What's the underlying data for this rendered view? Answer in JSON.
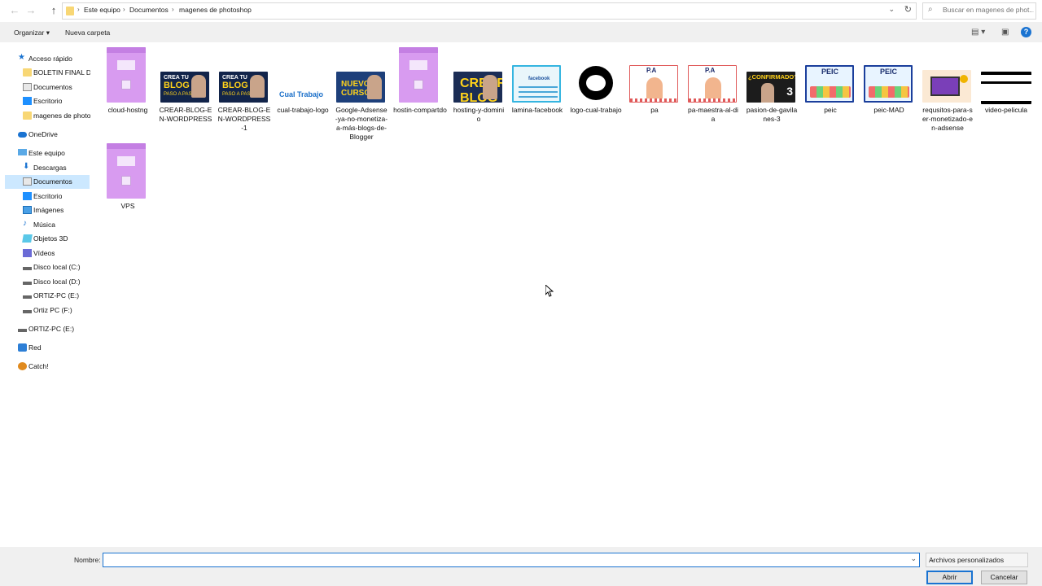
{
  "address": {
    "crumbs": [
      "Este equipo",
      "Documentos",
      "magenes de photoshop"
    ]
  },
  "search": {
    "placeholder": "Buscar en magenes de phot..."
  },
  "toolbar": {
    "organize": "Organizar",
    "new_folder": "Nueva carpeta"
  },
  "sidebar": {
    "quick_access": "Acceso rápido",
    "items": [
      "BOLETIN FINAL DES",
      "Documentos",
      "Escritorio",
      "magenes de photos",
      "OneDrive",
      "Este equipo",
      "Descargas",
      "Documentos",
      "Escritorio",
      "Imágenes",
      "Música",
      "Objetos 3D",
      "Vídeos",
      "Disco local (C:)",
      "Disco local (D:)",
      "ORTIZ-PC (E:)",
      "Ortiz PC (F:)",
      "ORTIZ-PC (E:)",
      "Red",
      "Catch!"
    ]
  },
  "files": [
    {
      "name": "cloud-hostng",
      "icon": "purple-placeholder"
    },
    {
      "name": "CREAR-BLOG-EN-WORDPRESS",
      "icon": "blog-thumbnail"
    },
    {
      "name": "CREAR-BLOG-EN-WORDPRESS-1",
      "icon": "blog-thumbnail"
    },
    {
      "name": "cual-trabajo-logo",
      "icon": "logo-thumbnail"
    },
    {
      "name": "Google-Adsense-ya-no-monetiza-a-más-blogs-de-Blogger",
      "icon": "course-thumbnail"
    },
    {
      "name": "hostin-compartdo",
      "icon": "purple-placeholder"
    },
    {
      "name": "hosting-y-dominio",
      "icon": "hosting-thumbnail"
    },
    {
      "name": "lamina-facebook",
      "icon": "lamina-thumbnail"
    },
    {
      "name": "logo-cual-trabajo",
      "icon": "black-logo-thumbnail"
    },
    {
      "name": "pa",
      "icon": "pa-thumbnail"
    },
    {
      "name": "pa-maestra-al-dia",
      "icon": "pa-thumbnail"
    },
    {
      "name": "pasion-de-gavilanes-3",
      "icon": "pasion-thumbnail"
    },
    {
      "name": "peic",
      "icon": "peic-thumbnail"
    },
    {
      "name": "peic-MAD",
      "icon": "peic-thumbnail"
    },
    {
      "name": "requsitos-para-ser-monetizado-en-adsense",
      "icon": "requisitos-thumbnail"
    },
    {
      "name": "video-pelicula",
      "icon": "video-thumbnail"
    },
    {
      "name": "VPS",
      "icon": "purple-placeholder"
    }
  ],
  "thumb_text": {
    "blog_top": "CREA TU",
    "blog_main": "BLOG",
    "blog_sub": "PASO A PASO",
    "cual_trabajo": "Cual Trabajo",
    "nuevo_curso": "NUEVO CURSO",
    "crear_blog": "CREAR BLOG",
    "facebook": "facebook",
    "pa": "P.A",
    "confirmado": "¿CONFIRMADO?",
    "three": "3",
    "peic": "PEIC"
  },
  "bottom": {
    "name_label": "Nombre:",
    "name_value": "",
    "file_type": "Archivos personalizados",
    "open": "Abrir",
    "cancel": "Cancelar"
  },
  "colors": {
    "accent": "#1a73d1",
    "selection": "#cce8ff",
    "folder": "#f8d775",
    "placeholder": "#d89bf0"
  }
}
